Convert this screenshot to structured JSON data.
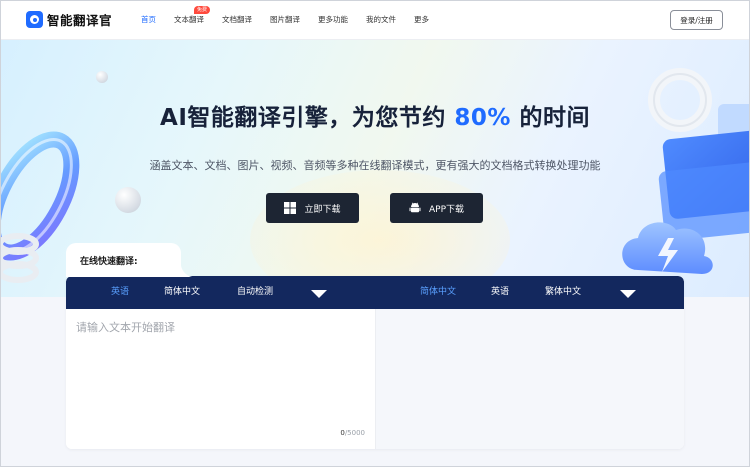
{
  "brand": {
    "name": "智能翻译官",
    "accent": "#1f6bff"
  },
  "nav": {
    "items": [
      {
        "label": "首页",
        "active": true
      },
      {
        "label": "文本翻译",
        "badge": "免费"
      },
      {
        "label": "文档翻译"
      },
      {
        "label": "图片翻译"
      },
      {
        "label": "更多功能"
      },
      {
        "label": "我的文件"
      },
      {
        "label": "更多"
      }
    ],
    "login_label": "登录/注册"
  },
  "hero": {
    "title_prefix": "AI智能翻译引擎，为您节约",
    "title_highlight": "80%",
    "title_suffix": "的时间",
    "subtitle": "涵盖文本、文档、图片、视频、音频等多种在线翻译模式，更有强大的文档格式转换处理功能",
    "windows_download": "立即下载",
    "app_download": "APP下载"
  },
  "translator": {
    "section_label": "在线快速翻译:",
    "source_langs": [
      "英语",
      "简体中文",
      "自动检测"
    ],
    "target_langs": [
      "简体中文",
      "英语",
      "繁体中文"
    ],
    "input_placeholder": "请输入文本开始翻译",
    "count_current": "0",
    "count_max": "/5000"
  },
  "icons": {
    "windows": "windows-icon",
    "android": "android-icon",
    "dropdown": "chevron-down-icon"
  }
}
